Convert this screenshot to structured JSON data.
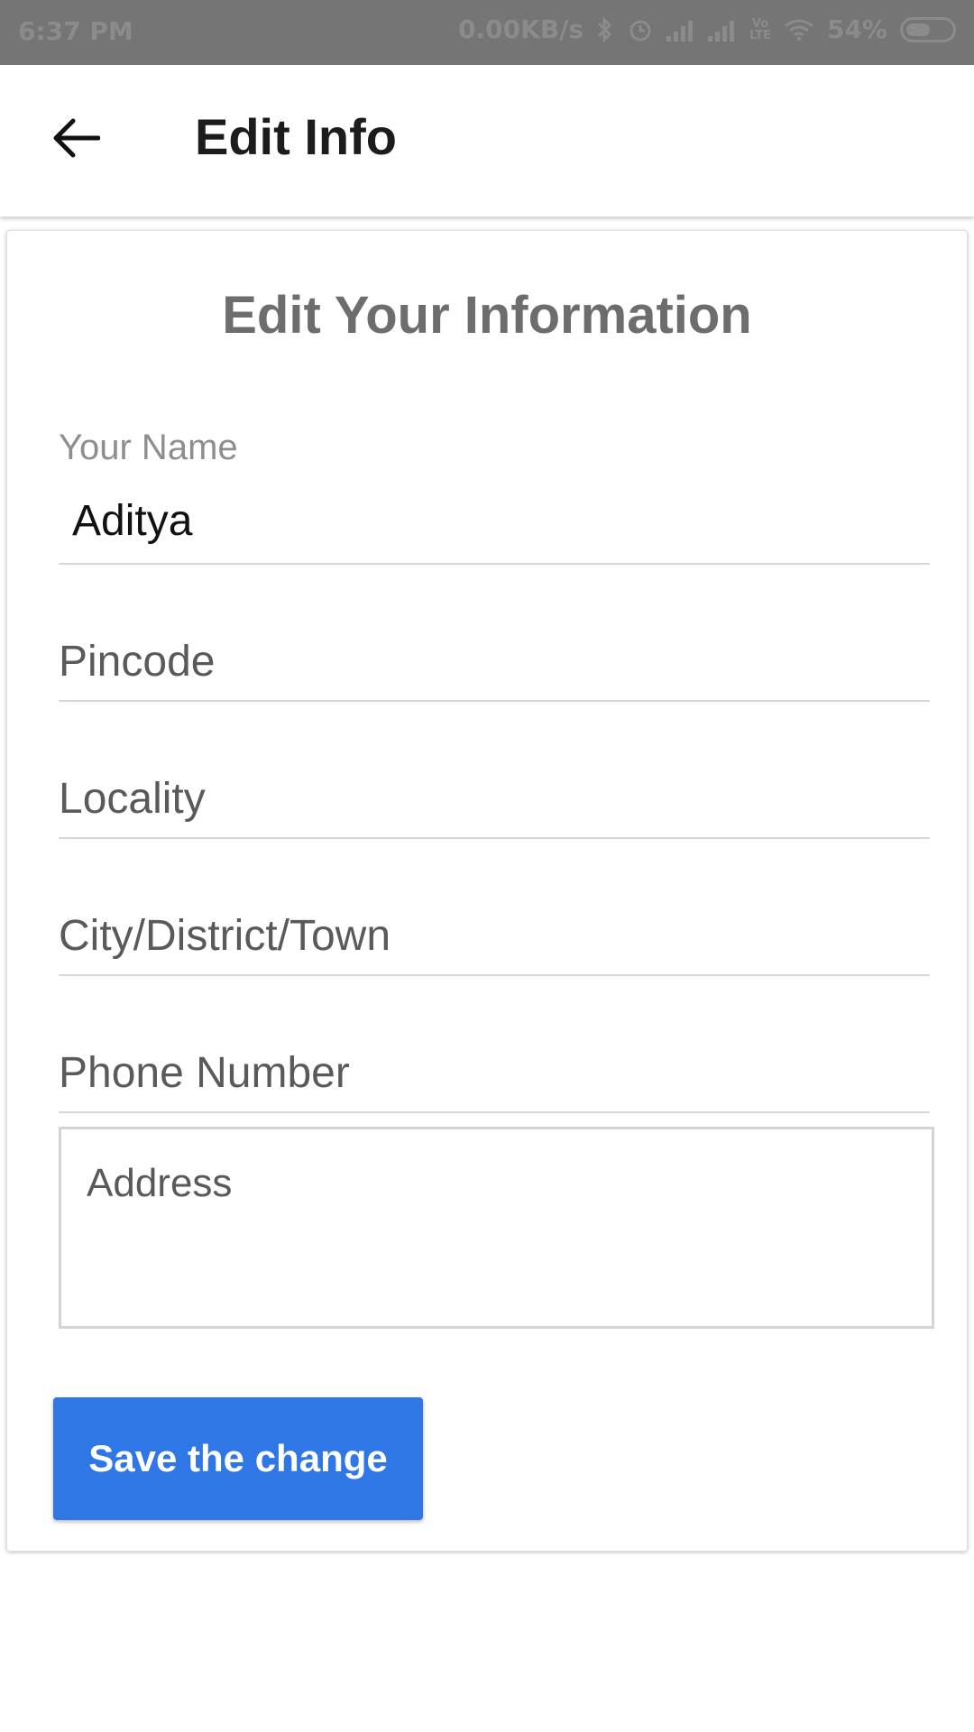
{
  "status_bar": {
    "time": "6:37 PM",
    "network_speed": "0.00KB/s",
    "battery_percent": "54%",
    "network_badge_top": "Vo",
    "network_badge_bottom": "LTE",
    "icons": [
      "bluetooth-icon",
      "alarm-icon",
      "signal-icon",
      "signal-icon",
      "volte-icon",
      "wifi-icon",
      "battery-icon"
    ]
  },
  "app_bar": {
    "title": "Edit Info",
    "back_icon": "arrow-left-icon"
  },
  "form": {
    "heading": "Edit Your Information",
    "name": {
      "label": "Your Name",
      "value": "Aditya"
    },
    "pincode": {
      "placeholder": "Pincode"
    },
    "locality": {
      "placeholder": "Locality"
    },
    "city": {
      "placeholder": "City/District/Town"
    },
    "phone": {
      "placeholder": "Phone Number"
    },
    "address": {
      "placeholder": "Address"
    },
    "save_label": "Save the change"
  },
  "colors": {
    "status_bar": "#757575",
    "primary_button": "#2f77e6",
    "heading_text": "#6d6d6d"
  }
}
